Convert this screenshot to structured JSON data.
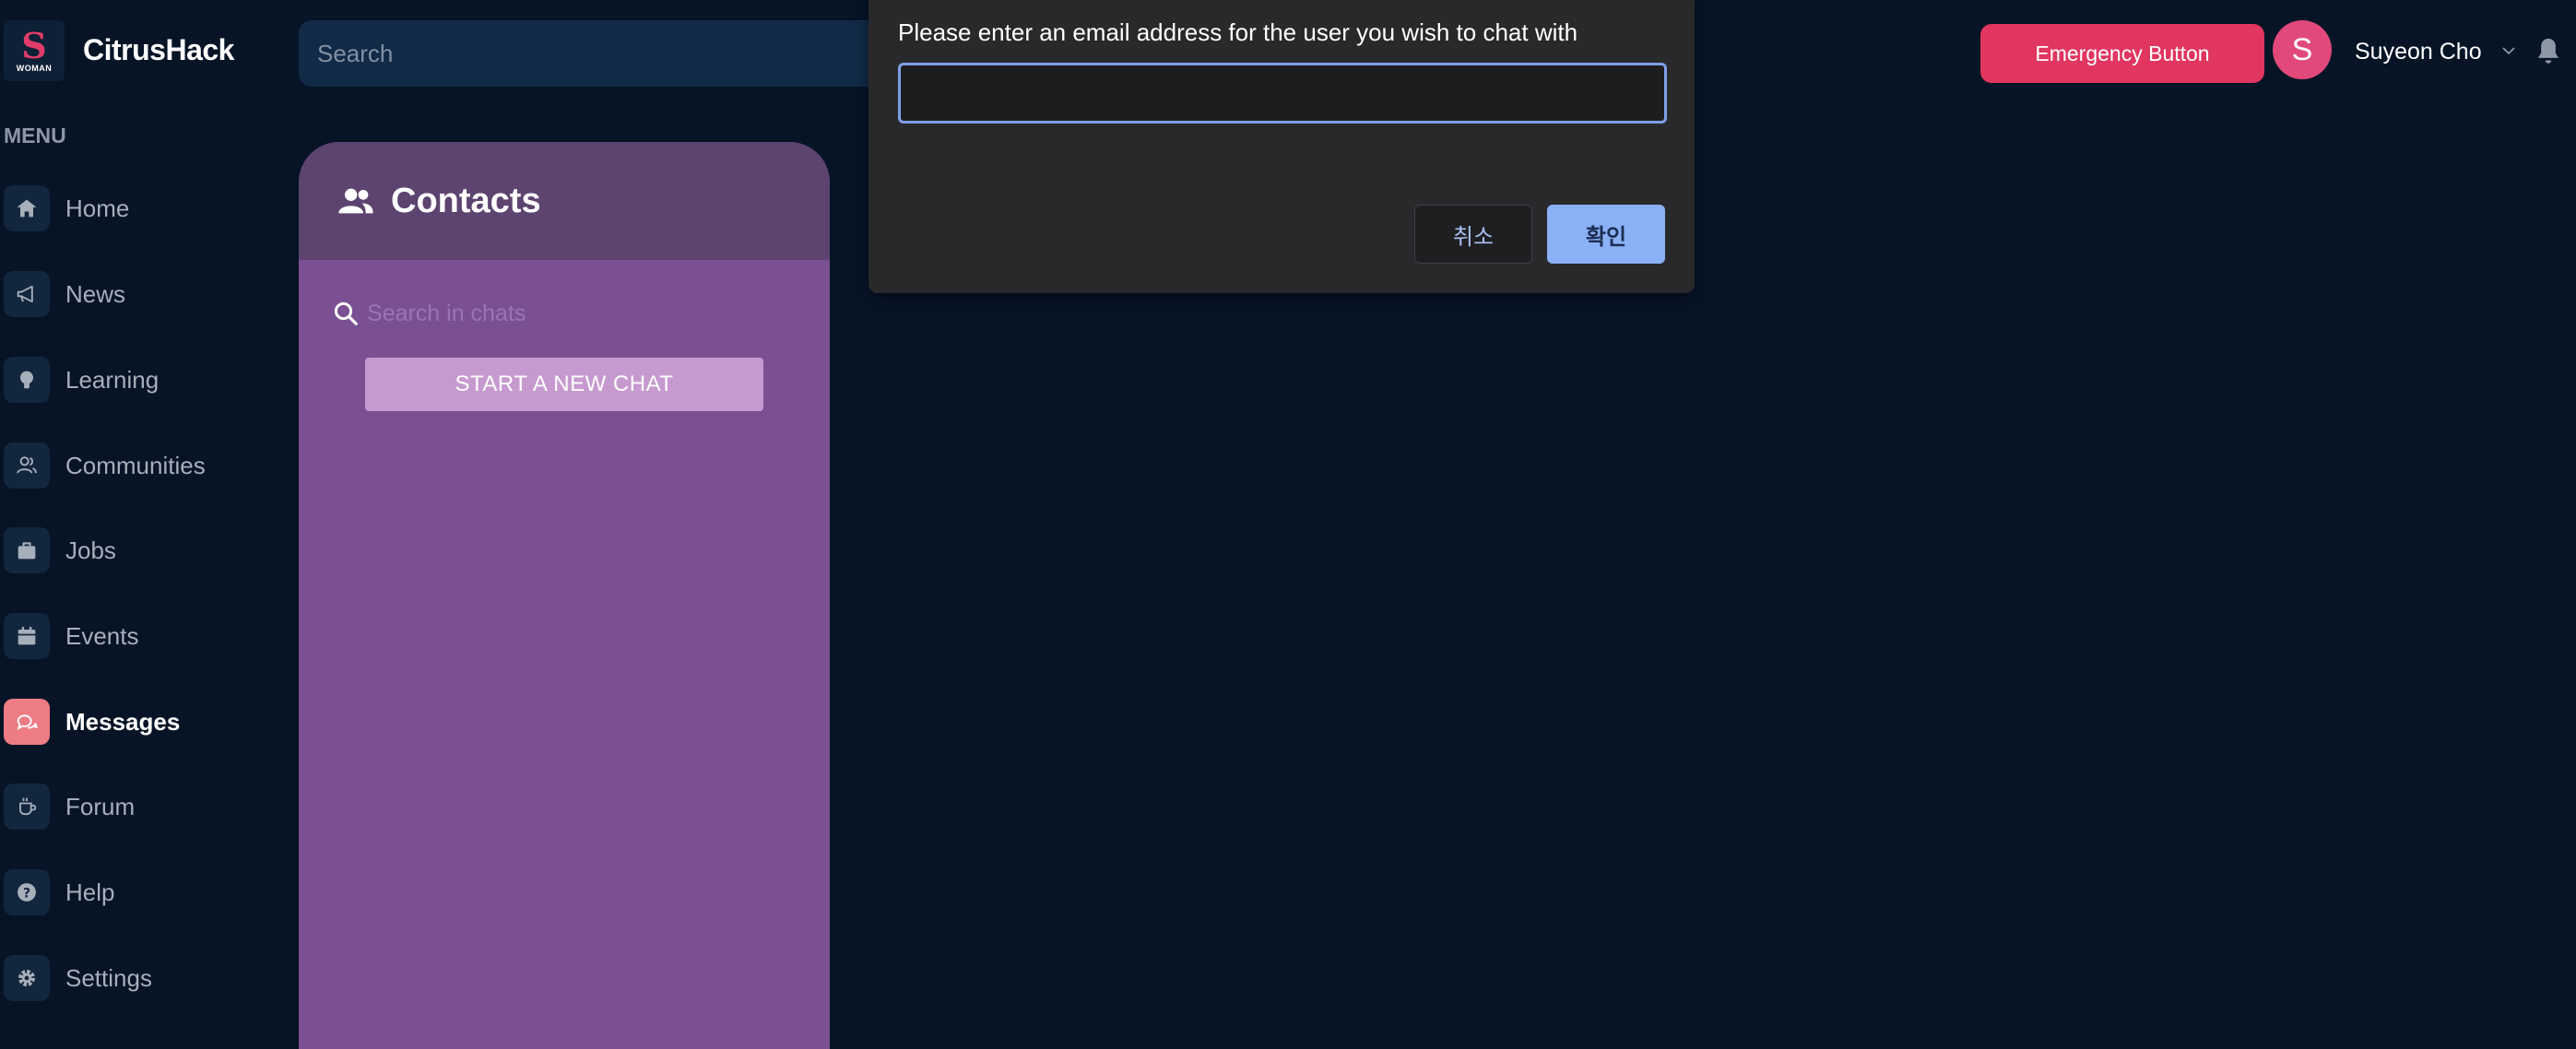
{
  "brand": {
    "logo_letter": "S",
    "logo_text": "WOMAN",
    "name": "CitrusHack"
  },
  "header": {
    "search_placeholder": "Search",
    "emergency_label": "Emergency Button",
    "avatar_initial": "S",
    "username": "Suyeon Cho"
  },
  "sidebar": {
    "menu_label": "MENU",
    "items": [
      {
        "label": "Home",
        "icon": "home-icon"
      },
      {
        "label": "News",
        "icon": "megaphone-icon"
      },
      {
        "label": "Learning",
        "icon": "lightbulb-icon"
      },
      {
        "label": "Communities",
        "icon": "users-icon"
      },
      {
        "label": "Jobs",
        "icon": "briefcase-icon"
      },
      {
        "label": "Events",
        "icon": "calendar-icon"
      },
      {
        "label": "Messages",
        "icon": "chat-icon",
        "active": true
      },
      {
        "label": "Forum",
        "icon": "coffee-icon"
      },
      {
        "label": "Help",
        "icon": "help-icon"
      },
      {
        "label": "Settings",
        "icon": "gear-icon"
      }
    ]
  },
  "contacts": {
    "title": "Contacts",
    "search_placeholder": "Search in chats",
    "new_chat_label": "START A NEW CHAT"
  },
  "dialog": {
    "message": "Please enter an email address for the user you wish to chat with",
    "input_value": "",
    "cancel_label": "취소",
    "ok_label": "확인"
  },
  "colors": {
    "background": "#061426",
    "sidebar_icon_bg": "#12263d",
    "active_icon_bg": "#ee7c84",
    "emergency": "#e0365f",
    "avatar": "#e0497a",
    "contacts_panel": "#7a5093",
    "contacts_header": "#5d4470",
    "new_chat_button": "#c69acf",
    "dialog_bg": "#29292c",
    "dialog_accent": "#8ab0f5"
  }
}
